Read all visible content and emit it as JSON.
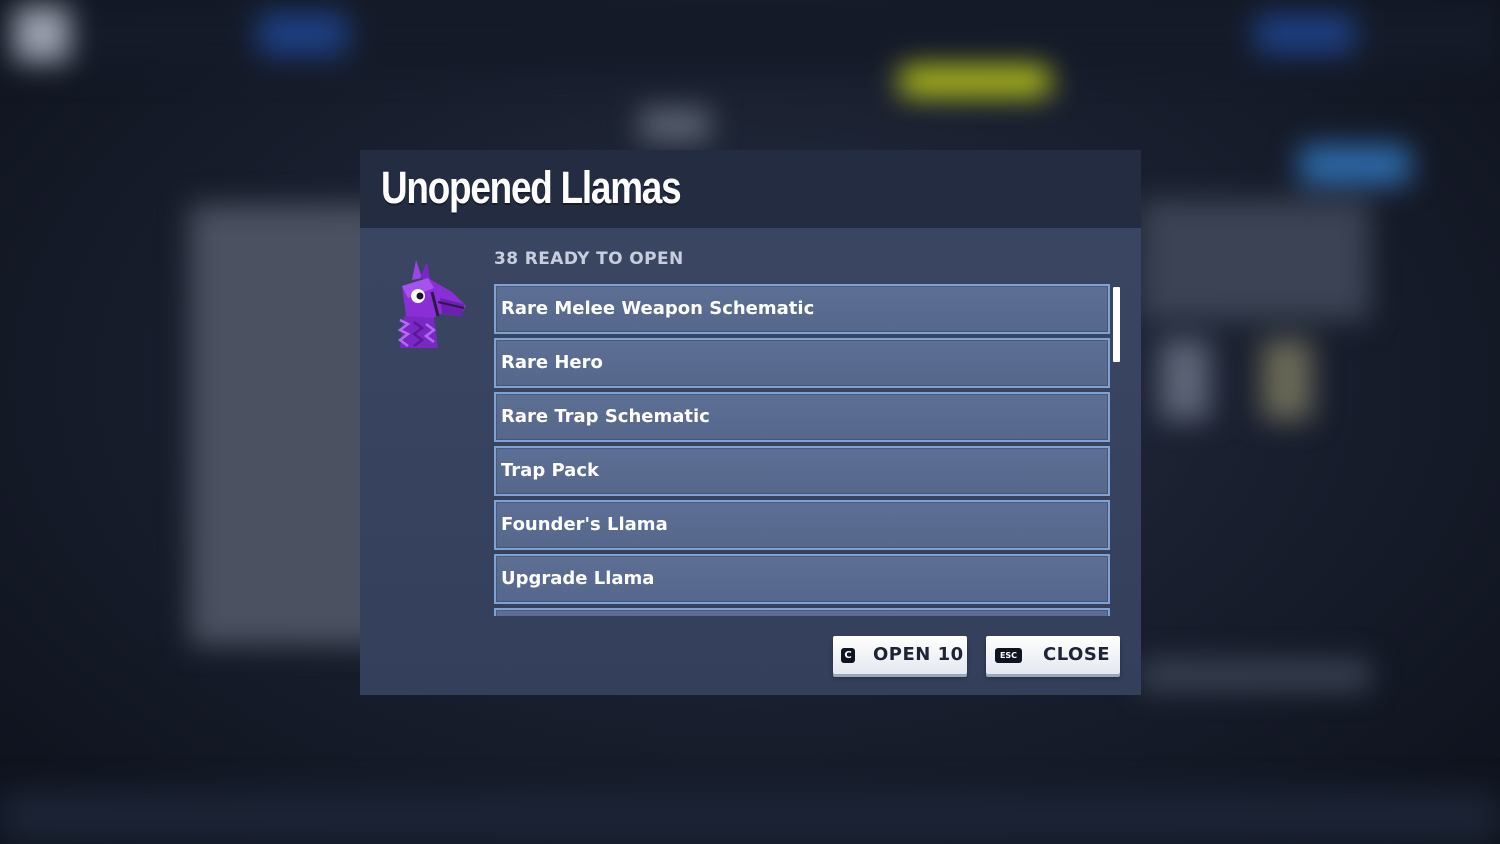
{
  "dialog": {
    "title": "Unopened Llamas",
    "ready_text": "38 READY TO OPEN",
    "icon": "llama-pinata-icon"
  },
  "llama_list": {
    "items": [
      {
        "label": "Rare Melee Weapon Schematic"
      },
      {
        "label": "Rare Hero"
      },
      {
        "label": "Rare Trap Schematic"
      },
      {
        "label": "Trap Pack"
      },
      {
        "label": "Founder's Llama"
      },
      {
        "label": "Upgrade Llama"
      },
      {
        "label": ""
      }
    ]
  },
  "actions": {
    "open": {
      "key": "C",
      "label": "OPEN 10"
    },
    "close": {
      "key": "ESC",
      "label": "CLOSE"
    }
  },
  "colors": {
    "dialog_bg": "#37425e",
    "header_bg": "#232c40",
    "item_bg": "#5a6c90",
    "item_border": "#7fa1d3",
    "llama_purple": "#8a2fd6"
  }
}
